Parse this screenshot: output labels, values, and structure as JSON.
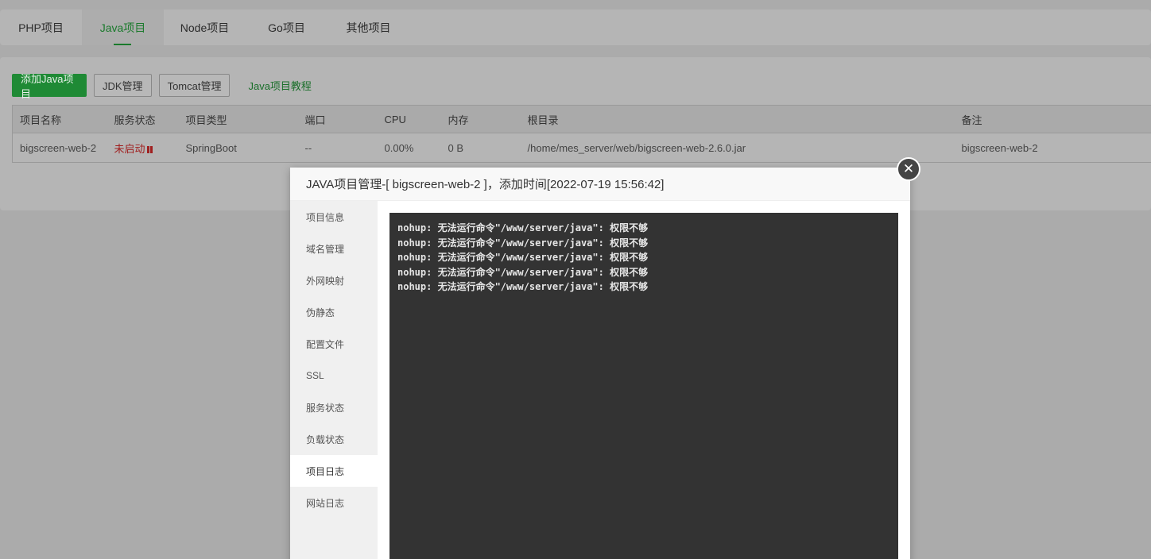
{
  "tabs": [
    {
      "label": "PHP项目"
    },
    {
      "label": "Java项目"
    },
    {
      "label": "Node项目"
    },
    {
      "label": "Go项目"
    },
    {
      "label": "其他项目"
    }
  ],
  "toolbar": {
    "add_label": "添加Java项目",
    "jdk_label": "JDK管理",
    "tomcat_label": "Tomcat管理",
    "tutorial_label": "Java项目教程"
  },
  "table": {
    "headers": [
      "项目名称",
      "服务状态",
      "项目类型",
      "端口",
      "CPU",
      "内存",
      "根目录",
      "备注"
    ],
    "row": {
      "name": "bigscreen-web-2",
      "status": "未启动",
      "type": "SpringBoot",
      "port": "--",
      "cpu": "0.00%",
      "mem": "0 B",
      "root": "/home/mes_server/web/bigscreen-web-2.6.0.jar",
      "note": "bigscreen-web-2"
    }
  },
  "modal": {
    "title": "JAVA项目管理-[ bigscreen-web-2 ]，添加时间[2022-07-19 15:56:42]",
    "close_glyph": "✕",
    "menu": [
      "项目信息",
      "域名管理",
      "外网映射",
      "伪静态",
      "配置文件",
      "SSL",
      "服务状态",
      "负载状态",
      "项目日志",
      "网站日志"
    ],
    "active_menu": "项目日志",
    "log_lines": [
      "nohup: 无法运行命令\"/www/server/java\": 权限不够",
      "nohup: 无法运行命令\"/www/server/java\": 权限不够",
      "nohup: 无法运行命令\"/www/server/java\": 权限不够",
      "nohup: 无法运行命令\"/www/server/java\": 权限不够",
      "nohup: 无法运行命令\"/www/server/java\": 权限不够"
    ]
  }
}
